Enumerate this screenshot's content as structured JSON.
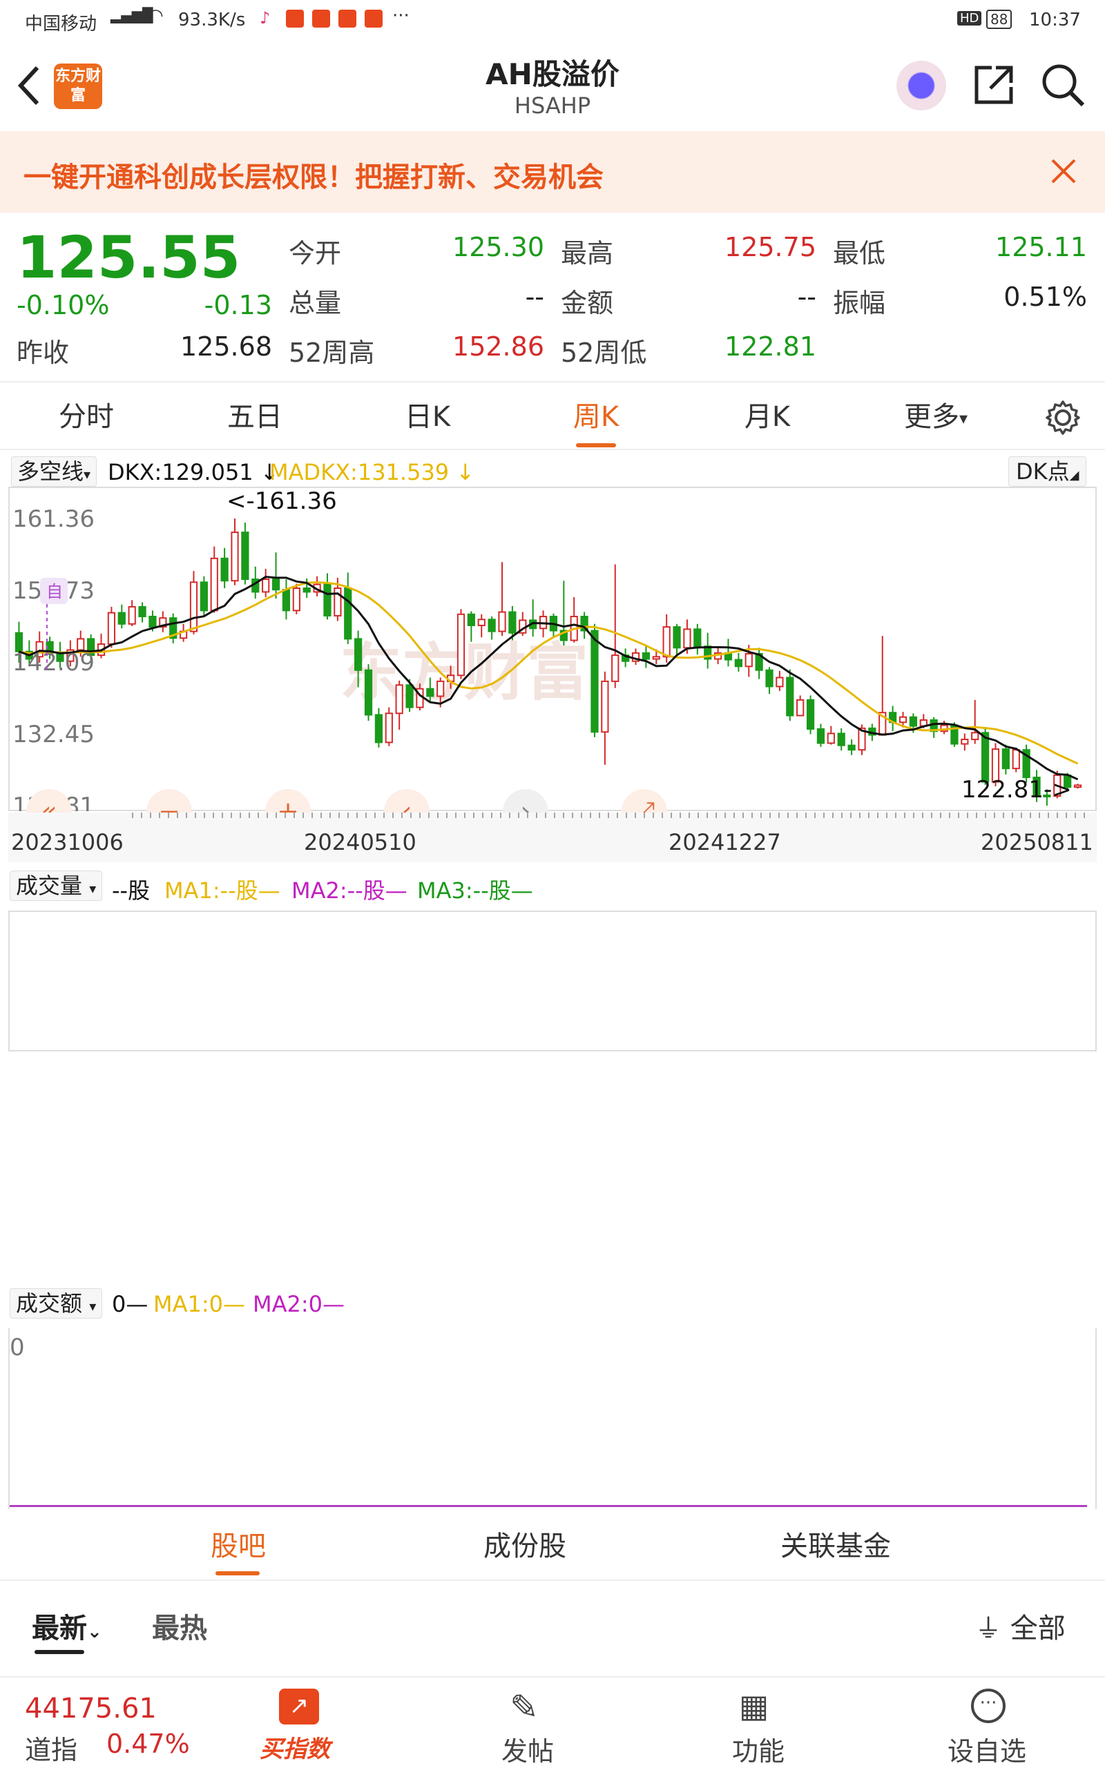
{
  "status_bar": {
    "carrier": "中国移动",
    "net_speed": "93.3K/s",
    "hd": "HD",
    "battery": "88",
    "time": "10:37"
  },
  "nav": {
    "logo_text": "东方财富",
    "title": "AH股溢价",
    "code": "HSAHP"
  },
  "banner": {
    "text": "一键开通科创成长层权限！把握打新、交易机会"
  },
  "quote": {
    "price": "125.55",
    "change_pct": "-0.10%",
    "change": "-0.13",
    "prev_close_label": "昨收",
    "prev_close": "125.68",
    "open_label": "今开",
    "open": "125.30",
    "high_label": "最高",
    "high": "125.75",
    "low_label": "最低",
    "low": "125.11",
    "volume_label": "总量",
    "volume": "--",
    "amount_label": "金额",
    "amount": "--",
    "amplitude_label": "振幅",
    "amplitude": "0.51%",
    "w52_high_label": "52周高",
    "w52_high": "152.86",
    "w52_low_label": "52周低",
    "w52_low": "122.81"
  },
  "period_tabs": [
    {
      "label": "分时",
      "active": false
    },
    {
      "label": "五日",
      "active": false
    },
    {
      "label": "日K",
      "active": false
    },
    {
      "label": "周K",
      "active": true
    },
    {
      "label": "月K",
      "active": false
    },
    {
      "label": "更多",
      "active": false
    }
  ],
  "indicator": {
    "selector": "多空线",
    "dkx": "DKX:129.051",
    "madkx": "MADKX:131.539",
    "right_selector": "DK点"
  },
  "chart_data": {
    "type": "candlestick",
    "y_ticks": [
      "161.36",
      "151.73",
      "142.09",
      "132.45",
      "122.81"
    ],
    "x_ticks": [
      "20231006",
      "20240510",
      "20241227",
      "20250811"
    ],
    "max_marker": "<-161.36",
    "min_marker": "122.81->",
    "self_marker": "自",
    "ylim": [
      122.81,
      161.36
    ],
    "candles": [
      [
        146.0,
        143.5,
        147.5,
        142.0
      ],
      [
        143.5,
        142.5,
        145.0,
        141.5
      ],
      [
        142.8,
        144.8,
        146.2,
        142.0
      ],
      [
        144.8,
        143.3,
        145.5,
        142.5
      ],
      [
        143.3,
        142.2,
        144.8,
        141.3
      ],
      [
        142.2,
        143.7,
        145.0,
        141.5
      ],
      [
        143.7,
        145.2,
        146.3,
        142.8
      ],
      [
        145.2,
        143.0,
        145.8,
        142.4
      ],
      [
        143.0,
        144.5,
        145.9,
        142.6
      ],
      [
        144.5,
        148.7,
        149.5,
        144.0
      ],
      [
        148.7,
        147.2,
        149.8,
        146.6
      ],
      [
        147.2,
        149.5,
        150.4,
        146.9
      ],
      [
        149.5,
        148.2,
        150.1,
        147.4
      ],
      [
        148.2,
        146.8,
        149.0,
        146.2
      ],
      [
        146.8,
        148.0,
        148.9,
        146.1
      ],
      [
        148.0,
        145.3,
        148.6,
        144.6
      ],
      [
        145.3,
        146.2,
        147.2,
        144.8
      ],
      [
        146.2,
        152.8,
        154.3,
        145.8
      ],
      [
        152.8,
        149.0,
        153.6,
        148.3
      ],
      [
        149.0,
        156.0,
        157.6,
        148.7
      ],
      [
        156.0,
        153.0,
        157.4,
        152.0
      ],
      [
        153.0,
        159.5,
        161.36,
        152.4
      ],
      [
        159.5,
        153.2,
        160.8,
        152.5
      ],
      [
        153.2,
        151.5,
        154.9,
        150.6
      ],
      [
        151.5,
        153.2,
        154.6,
        150.8
      ],
      [
        153.2,
        151.8,
        156.8,
        150.6
      ],
      [
        151.8,
        149.0,
        153.2,
        147.8
      ],
      [
        149.0,
        152.0,
        152.6,
        148.5
      ],
      [
        152.0,
        151.5,
        153.3,
        150.7
      ],
      [
        151.5,
        152.5,
        153.6,
        150.9
      ],
      [
        152.5,
        148.3,
        154.0,
        147.8
      ],
      [
        148.3,
        152.0,
        153.4,
        147.6
      ],
      [
        152.0,
        145.2,
        154.1,
        144.5
      ],
      [
        145.2,
        141.0,
        146.3,
        138.7
      ],
      [
        141.0,
        135.0,
        141.8,
        134.2
      ],
      [
        135.0,
        131.3,
        135.9,
        130.6
      ],
      [
        131.3,
        135.2,
        136.0,
        130.8
      ],
      [
        135.2,
        139.0,
        139.6,
        133.0
      ],
      [
        139.0,
        136.0,
        139.8,
        135.4
      ],
      [
        136.0,
        138.5,
        139.2,
        135.6
      ],
      [
        138.5,
        137.5,
        140.0,
        136.8
      ],
      [
        137.5,
        139.5,
        140.0,
        136.0
      ],
      [
        139.5,
        140.3,
        141.6,
        138.5
      ],
      [
        140.3,
        148.5,
        149.2,
        139.8
      ],
      [
        148.5,
        147.0,
        148.9,
        144.8
      ],
      [
        147.0,
        147.8,
        148.5,
        145.4
      ],
      [
        147.8,
        146.2,
        148.2,
        145.1
      ],
      [
        146.2,
        148.8,
        155.5,
        145.6
      ],
      [
        148.8,
        146.0,
        149.6,
        145.0
      ],
      [
        146.0,
        147.7,
        148.8,
        145.6
      ],
      [
        147.7,
        146.6,
        150.5,
        145.5
      ],
      [
        146.6,
        148.2,
        149.0,
        145.4
      ],
      [
        148.2,
        146.3,
        148.6,
        145.4
      ],
      [
        146.3,
        145.0,
        153.0,
        144.3
      ],
      [
        145.0,
        148.2,
        150.8,
        144.7
      ],
      [
        148.2,
        146.3,
        148.8,
        145.2
      ],
      [
        146.3,
        132.7,
        147.2,
        132.0
      ],
      [
        132.7,
        139.5,
        140.8,
        128.3
      ],
      [
        139.5,
        143.0,
        155.2,
        138.6
      ],
      [
        143.0,
        142.2,
        143.9,
        141.4
      ],
      [
        142.2,
        143.3,
        143.9,
        141.7
      ],
      [
        143.3,
        142.5,
        144.3,
        141.3
      ],
      [
        142.5,
        142.8,
        143.8,
        141.8
      ],
      [
        142.8,
        146.8,
        148.5,
        142.0
      ],
      [
        146.8,
        144.0,
        147.2,
        142.7
      ],
      [
        144.0,
        146.5,
        147.8,
        143.2
      ],
      [
        146.5,
        144.2,
        147.2,
        143.1
      ],
      [
        144.2,
        142.5,
        146.0,
        141.2
      ],
      [
        142.5,
        143.3,
        144.2,
        141.8
      ],
      [
        143.3,
        142.4,
        145.2,
        141.5
      ],
      [
        142.4,
        141.5,
        143.3,
        140.8
      ],
      [
        141.5,
        143.2,
        144.4,
        140.1
      ],
      [
        143.2,
        141.0,
        144.0,
        139.8
      ],
      [
        141.0,
        138.8,
        141.4,
        137.8
      ],
      [
        138.8,
        140.0,
        140.9,
        138.2
      ],
      [
        140.0,
        134.9,
        141.1,
        134.2
      ],
      [
        134.9,
        137.0,
        137.6,
        135.6
      ],
      [
        137.0,
        133.1,
        137.6,
        132.4
      ],
      [
        133.1,
        131.2,
        133.8,
        130.7
      ],
      [
        131.2,
        132.5,
        133.5,
        131.0
      ],
      [
        132.5,
        130.9,
        133.2,
        130.2
      ],
      [
        130.9,
        130.3,
        131.7,
        129.6
      ],
      [
        130.3,
        133.2,
        133.7,
        129.6
      ],
      [
        133.2,
        132.3,
        133.8,
        131.5
      ],
      [
        132.3,
        135.3,
        145.6,
        134.6
      ],
      [
        135.3,
        134.0,
        136.2,
        132.8
      ],
      [
        134.0,
        134.7,
        135.4,
        133.3
      ],
      [
        134.7,
        133.5,
        135.2,
        132.6
      ],
      [
        133.5,
        134.3,
        135.1,
        133.2
      ],
      [
        134.3,
        132.8,
        134.7,
        131.9
      ],
      [
        132.8,
        133.6,
        134.2,
        132.4
      ],
      [
        133.6,
        131.1,
        134.0,
        130.7
      ],
      [
        131.1,
        131.7,
        132.5,
        130.2
      ],
      [
        131.7,
        132.6,
        137.0,
        131.1
      ],
      [
        132.6,
        126.0,
        133.2,
        125.6
      ],
      [
        126.0,
        130.4,
        131.2,
        125.4
      ],
      [
        130.4,
        127.8,
        131.0,
        127.0
      ],
      [
        127.8,
        130.3,
        130.6,
        127.3
      ],
      [
        130.3,
        126.6,
        131.0,
        125.9
      ],
      [
        126.6,
        124.2,
        127.6,
        123.3
      ],
      [
        124.2,
        124.1,
        125.0,
        122.81
      ],
      [
        124.1,
        126.9,
        127.5,
        123.8
      ],
      [
        126.9,
        125.3,
        127.2,
        125.0
      ],
      [
        125.3,
        125.55,
        125.75,
        125.11
      ]
    ]
  },
  "chart_buttons": [
    "«",
    "−",
    "+",
    "‹",
    "›",
    "⤢"
  ],
  "volume_panel": {
    "selector": "成交量",
    "value": "--股",
    "ma1": "MA1:--股",
    "ma2": "MA2:--股",
    "ma3": "MA3:--股"
  },
  "amount_panel": {
    "selector": "成交额",
    "value": "0",
    "ma1": "MA1:0",
    "ma2": "MA2:0",
    "zero": "0"
  },
  "section_tabs": [
    {
      "label": "股吧",
      "active": true
    },
    {
      "label": "成份股",
      "active": false
    },
    {
      "label": "关联基金",
      "active": false
    }
  ],
  "sort": {
    "latest": "最新",
    "hot": "最热",
    "filter": "全部"
  },
  "bottom_nav": {
    "index_value": "44175.61",
    "index_name": "道指",
    "index_change": "0.47%",
    "buy": "买指数",
    "post": "发帖",
    "func": "功能",
    "watch": "设自选"
  },
  "colors": {
    "up": "#d42a2a",
    "down": "#1a9a1a",
    "accent": "#e8661c",
    "dkx": "#111111",
    "madkx": "#e6b800"
  }
}
